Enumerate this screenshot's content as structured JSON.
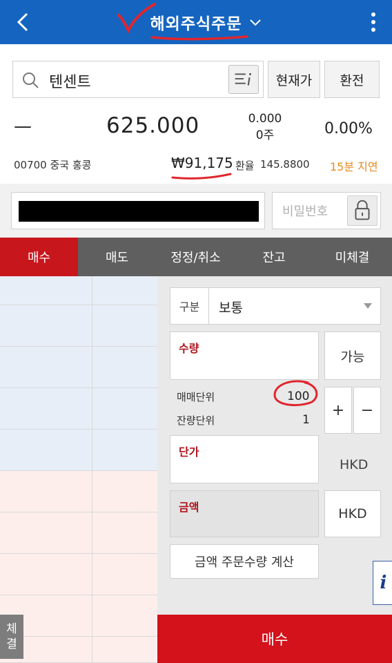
{
  "header": {
    "title": "해외주식주문",
    "bg_color": "#1565c0"
  },
  "search": {
    "value": "텐센트"
  },
  "buttons": {
    "current_price": "현재가",
    "exchange": "환전"
  },
  "quote": {
    "change_sign": "—",
    "price": "625.000",
    "change_amount": "0.000",
    "volume": "0주",
    "change_pct": "0.00%"
  },
  "info": {
    "code_market": "00700 중국 홍콩",
    "krw_price": "₩91,175",
    "rate_label": "환율",
    "rate_value": "145.8800",
    "delay": "15분 지연"
  },
  "account": {
    "password_placeholder": "비밀번호"
  },
  "tabs": [
    {
      "label": "매수",
      "active": true
    },
    {
      "label": "매도",
      "active": false
    },
    {
      "label": "정정/취소",
      "active": false
    },
    {
      "label": "잔고",
      "active": false
    },
    {
      "label": "미체결",
      "active": false
    }
  ],
  "form": {
    "gubun_label": "구분",
    "gubun_value": "보통",
    "qty_label": "수량",
    "available_btn": "가능",
    "trade_unit_label": "매매단위",
    "trade_unit_value": "100",
    "odd_unit_label": "잔량단위",
    "odd_unit_value": "1",
    "plus": "+",
    "minus": "−",
    "price_label": "단가",
    "price_currency": "HKD",
    "amount_label": "금액",
    "amount_currency": "HKD",
    "calc_btn": "금액 주문수량 계산",
    "info_glyph": "i"
  },
  "side": {
    "fills_line1": "체",
    "fills_line2": "결"
  },
  "buy_button": "매수",
  "colors": {
    "accent_red": "#d3121b",
    "tab_bg": "#5f5f5f",
    "ask_bg": "#e8eef8",
    "bid_bg": "#fdeeec",
    "delay": "#e58a1f"
  }
}
